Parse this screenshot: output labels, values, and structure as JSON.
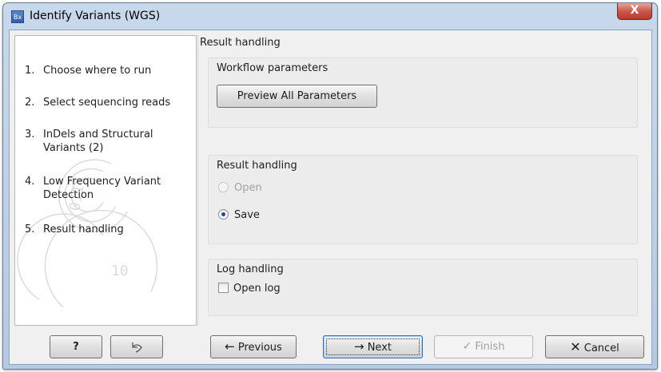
{
  "window": {
    "icon_text": "Bx",
    "title": "Identify Variants (WGS)",
    "close_glyph": "X"
  },
  "steps": [
    {
      "num": "1.",
      "label": "Choose where to run"
    },
    {
      "num": "2.",
      "label": "Select sequencing reads"
    },
    {
      "num": "3.",
      "label": "InDels and Structural Variants (2)"
    },
    {
      "num": "4.",
      "label": "Low Frequency Variant Detection"
    },
    {
      "num": "5.",
      "label": "Result handling"
    }
  ],
  "content": {
    "section_title": "Result handling",
    "workflow_group": {
      "title": "Workflow parameters",
      "preview_button": "Preview All Parameters"
    },
    "result_group": {
      "title": "Result handling",
      "options": [
        {
          "label": "Open",
          "selected": false,
          "enabled": false
        },
        {
          "label": "Save",
          "selected": true,
          "enabled": true
        }
      ]
    },
    "log_group": {
      "title": "Log handling",
      "checkbox_label": "Open log",
      "checked": false
    }
  },
  "buttons": {
    "help": "?",
    "reset_icon": "reset-arrow-icon",
    "previous": "Previous",
    "next": "Next",
    "finish": "Finish",
    "cancel": "Cancel"
  }
}
